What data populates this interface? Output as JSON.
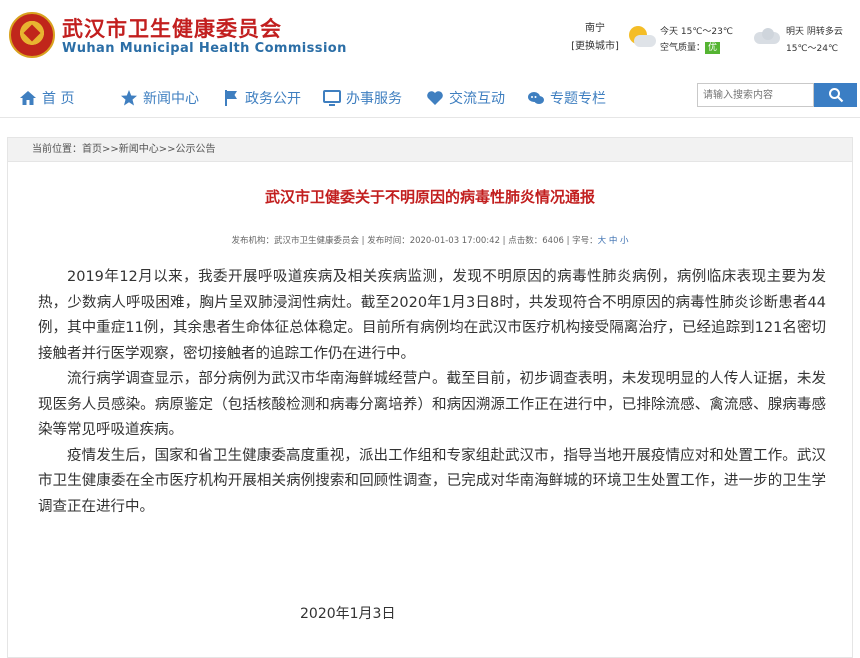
{
  "header": {
    "site_name_cn": "武汉市卫生健康委员会",
    "site_name_en": "Wuhan Municipal Health Commission",
    "city": "南宁",
    "change_city": "[更换城市]",
    "today_weather": "今天 15℃～23℃",
    "air_quality_label": "空气质量：",
    "air_quality_value": "优",
    "tomorrow_weather_line1": "明天 阴转多云",
    "tomorrow_weather_line2": "15℃～24℃"
  },
  "nav": {
    "items": [
      {
        "label": "首 页",
        "icon": "home-icon"
      },
      {
        "label": "新闻中心",
        "icon": "star-icon"
      },
      {
        "label": "政务公开",
        "icon": "flag-icon"
      },
      {
        "label": "办事服务",
        "icon": "monitor-icon"
      },
      {
        "label": "交流互动",
        "icon": "heart-icon"
      },
      {
        "label": "专题专栏",
        "icon": "chat-icon"
      }
    ],
    "search_placeholder": "请输入搜索内容"
  },
  "breadcrumb": "当前位置：首页>>新闻中心>>公示公告",
  "article": {
    "title": "武汉市卫健委关于不明原因的病毒性肺炎情况通报",
    "meta": "发布机构：武汉市卫生健康委员会 | 发布时间：2020-01-03 17:00:42 | 点击数：6406 | 字号：",
    "font_sizes": "大 中 小",
    "paragraphs": [
      "2019年12月以来，我委开展呼吸道疾病及相关疾病监测，发现不明原因的病毒性肺炎病例，病例临床表现主要为发热，少数病人呼吸困难，胸片呈双肺浸润性病灶。截至2020年1月3日8时，共发现符合不明原因的病毒性肺炎诊断患者44例，其中重症11例，其余患者生命体征总体稳定。目前所有病例均在武汉市医疗机构接受隔离治疗，已经追踪到121名密切接触者并行医学观察，密切接触者的追踪工作仍在进行中。",
      "流行病学调查显示，部分病例为武汉市华南海鲜城经营户。截至目前，初步调查表明，未发现明显的人传人证据，未发现医务人员感染。病原鉴定（包括核酸检测和病毒分离培养）和病因溯源工作正在进行中，已排除流感、禽流感、腺病毒感染等常见呼吸道疾病。",
      "疫情发生后，国家和省卫生健康委高度重视，派出工作组和专家组赴武汉市，指导当地开展疫情应对和处置工作。武汉市卫生健康委在全市医疗机构开展相关病例搜索和回顾性调查，已完成对华南海鲜城的环境卫生处置工作，进一步的卫生学调查正在进行中。"
    ],
    "date": "2020年1月3日"
  }
}
